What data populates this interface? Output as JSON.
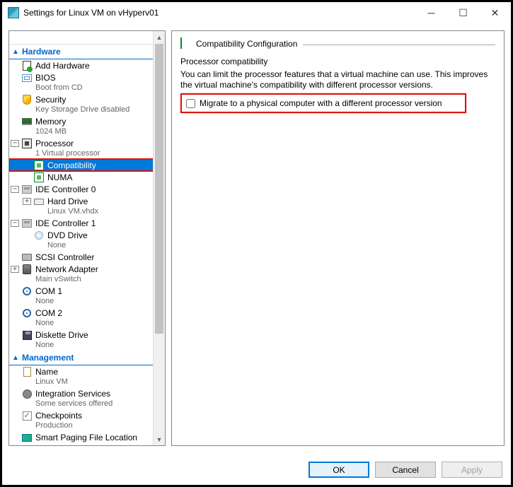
{
  "window": {
    "title": "Settings for Linux VM on vHyperv01"
  },
  "sections": {
    "hardware": "Hardware",
    "management": "Management"
  },
  "tree": {
    "add_hardware": "Add Hardware",
    "bios": {
      "label": "BIOS",
      "sub": "Boot from CD"
    },
    "security": {
      "label": "Security",
      "sub": "Key Storage Drive disabled"
    },
    "memory": {
      "label": "Memory",
      "sub": "1024 MB"
    },
    "processor": {
      "label": "Processor",
      "sub": "1 Virtual processor"
    },
    "compat": "Compatibility",
    "numa": "NUMA",
    "ide0": {
      "label": "IDE Controller 0"
    },
    "harddrive": {
      "label": "Hard Drive",
      "sub": "Linux VM.vhdx"
    },
    "ide1": {
      "label": "IDE Controller 1"
    },
    "dvd": {
      "label": "DVD Drive",
      "sub": "None"
    },
    "scsi": {
      "label": "SCSI Controller"
    },
    "net": {
      "label": "Network Adapter",
      "sub": "Main vSwitch"
    },
    "com1": {
      "label": "COM 1",
      "sub": "None"
    },
    "com2": {
      "label": "COM 2",
      "sub": "None"
    },
    "diskette": {
      "label": "Diskette Drive",
      "sub": "None"
    },
    "name": {
      "label": "Name",
      "sub": "Linux VM"
    },
    "integ": {
      "label": "Integration Services",
      "sub": "Some services offered"
    },
    "checkp": {
      "label": "Checkpoints",
      "sub": "Production"
    },
    "smart": {
      "label": "Smart Paging File Location"
    }
  },
  "content": {
    "header": "Compatibility Configuration",
    "group": "Processor compatibility",
    "desc": "You can limit the processor features that a virtual machine can use. This improves the virtual machine's compatibility with different processor versions.",
    "checkbox": "Migrate to a physical computer with a different processor version"
  },
  "buttons": {
    "ok": "OK",
    "cancel": "Cancel",
    "apply": "Apply"
  }
}
